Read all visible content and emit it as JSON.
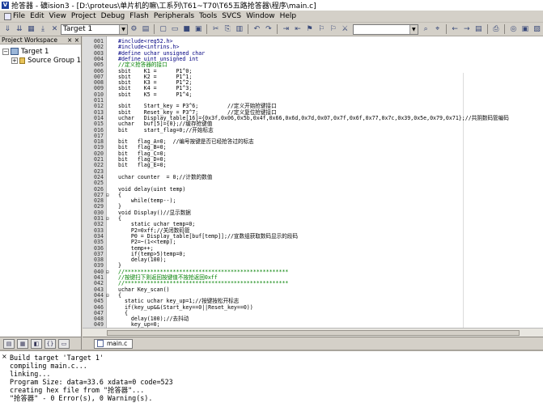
{
  "window": {
    "title": "抢答器 - 礦ision3 - [D:\\proteus\\单片机的嘛\\工系列\\T61~T70\\T65五路抢答器\\程序\\main.c]"
  },
  "menu": [
    "File",
    "Edit",
    "View",
    "Project",
    "Debug",
    "Flash",
    "Peripherals",
    "Tools",
    "SVCS",
    "Window",
    "Help"
  ],
  "toolbar": {
    "target": "Target 1"
  },
  "workspace": {
    "title": "Project Workspace",
    "close": "× ×",
    "root": "Target 1",
    "group": "Source Group 1"
  },
  "editor": {
    "lines": [
      {
        "n": "001",
        "f": "",
        "t": "#include<reg52.h>"
      },
      {
        "n": "002",
        "f": "",
        "t": "#include<intrins.h>"
      },
      {
        "n": "003",
        "f": "",
        "t": "#define uchar unsigned char"
      },
      {
        "n": "004",
        "f": "",
        "t": "#define uint unsigned int"
      },
      {
        "n": "005",
        "f": "",
        "t": "//定义抢答器的接口"
      },
      {
        "n": "006",
        "f": "",
        "t": "sbit    K1 =      P1^0;"
      },
      {
        "n": "007",
        "f": "",
        "t": "sbit    K2 =      P1^1;"
      },
      {
        "n": "008",
        "f": "",
        "t": "sbit    K3 =      P1^2;"
      },
      {
        "n": "009",
        "f": "",
        "t": "sbit    K4 =      P1^3;"
      },
      {
        "n": "010",
        "f": "",
        "t": "sbit    K5 =      P1^4;"
      },
      {
        "n": "011",
        "f": "",
        "t": ""
      },
      {
        "n": "012",
        "f": "",
        "t": "sbit    Start_key = P3^6;         //定义开始抢键接口"
      },
      {
        "n": "013",
        "f": "",
        "t": "sbit    Reset_key = P3^7;         //定义复位抢键接口"
      },
      {
        "n": "014",
        "f": "",
        "t": "uchar   Display_table[16]={0x3f,0x06,0x5b,0x4f,0x66,0x6d,0x7d,0x07,0x7f,0x6f,0x77,0x7c,0x39,0x5e,0x79,0x71};//共阴数码管编码"
      },
      {
        "n": "015",
        "f": "",
        "t": "uchar   buf[5]={0};//缓存抢键值"
      },
      {
        "n": "016",
        "f": "",
        "t": "bit     start_flag=0;//开始标志"
      },
      {
        "n": "017",
        "f": "",
        "t": ""
      },
      {
        "n": "018",
        "f": "",
        "t": "bit   flag_A=0;  //编号按键是否已经抢答过的标志"
      },
      {
        "n": "019",
        "f": "",
        "t": "bit   flag_B=0;"
      },
      {
        "n": "020",
        "f": "",
        "t": "bit   flag_C=0;"
      },
      {
        "n": "021",
        "f": "",
        "t": "bit   flag_D=0;"
      },
      {
        "n": "022",
        "f": "",
        "t": "bit   flag_E=0;"
      },
      {
        "n": "023",
        "f": "",
        "t": ""
      },
      {
        "n": "024",
        "f": "",
        "t": "uchar counter  = 0;//计数的数值"
      },
      {
        "n": "025",
        "f": "",
        "t": ""
      },
      {
        "n": "026",
        "f": "",
        "t": "void delay(uint temp)"
      },
      {
        "n": "027",
        "f": "⊟",
        "t": "{"
      },
      {
        "n": "028",
        "f": "",
        "t": "    while(temp--);"
      },
      {
        "n": "029",
        "f": "",
        "t": "}"
      },
      {
        "n": "030",
        "f": "",
        "t": "void Display()//显示数据"
      },
      {
        "n": "031",
        "f": "⊟",
        "t": "{"
      },
      {
        "n": "032",
        "f": "",
        "t": "    static uchar temp=0;"
      },
      {
        "n": "033",
        "f": "",
        "t": "    P2=0xff;//关闭数码管"
      },
      {
        "n": "034",
        "f": "",
        "t": "    P0 = Display_table[buf[temp]];//宣数组获取数码显示的段码"
      },
      {
        "n": "035",
        "f": "",
        "t": "    P2=~(1<<temp);"
      },
      {
        "n": "036",
        "f": "",
        "t": "    temp++;"
      },
      {
        "n": "037",
        "f": "",
        "t": "    if(temp>5)temp=0;"
      },
      {
        "n": "038",
        "f": "",
        "t": "    delay(100);"
      },
      {
        "n": "039",
        "f": "",
        "t": "}"
      },
      {
        "n": "040",
        "f": "⊟",
        "t": "//***************************************************"
      },
      {
        "n": "041",
        "f": "",
        "t": "//按键扫下则返回按键值不按抢返回0xff"
      },
      {
        "n": "042",
        "f": "",
        "t": "//***************************************************"
      },
      {
        "n": "043",
        "f": "",
        "t": "uchar Key_scan()"
      },
      {
        "n": "044",
        "f": "⊟",
        "t": "{"
      },
      {
        "n": "045",
        "f": "",
        "t": "  static uchar key_up=1;//按键按松开标志"
      },
      {
        "n": "046",
        "f": "",
        "t": "  if(key_up&&(Start_key==0||Reset_key==0))"
      },
      {
        "n": "047",
        "f": "",
        "t": "  {"
      },
      {
        "n": "048",
        "f": "",
        "t": "    delay(100);//去抖动"
      },
      {
        "n": "049",
        "f": "",
        "t": "    key_up=0;"
      }
    ],
    "filetab": "main.c"
  },
  "build": {
    "lines": [
      "Build target 'Target 1'",
      "compiling main.c...",
      "linking...",
      "Program Size: data=33.6 xdata=0 code=523",
      "creating hex file from \"抢答器\"...",
      "\"抢答器\" - 0 Error(s), 0 Warning(s)."
    ]
  }
}
